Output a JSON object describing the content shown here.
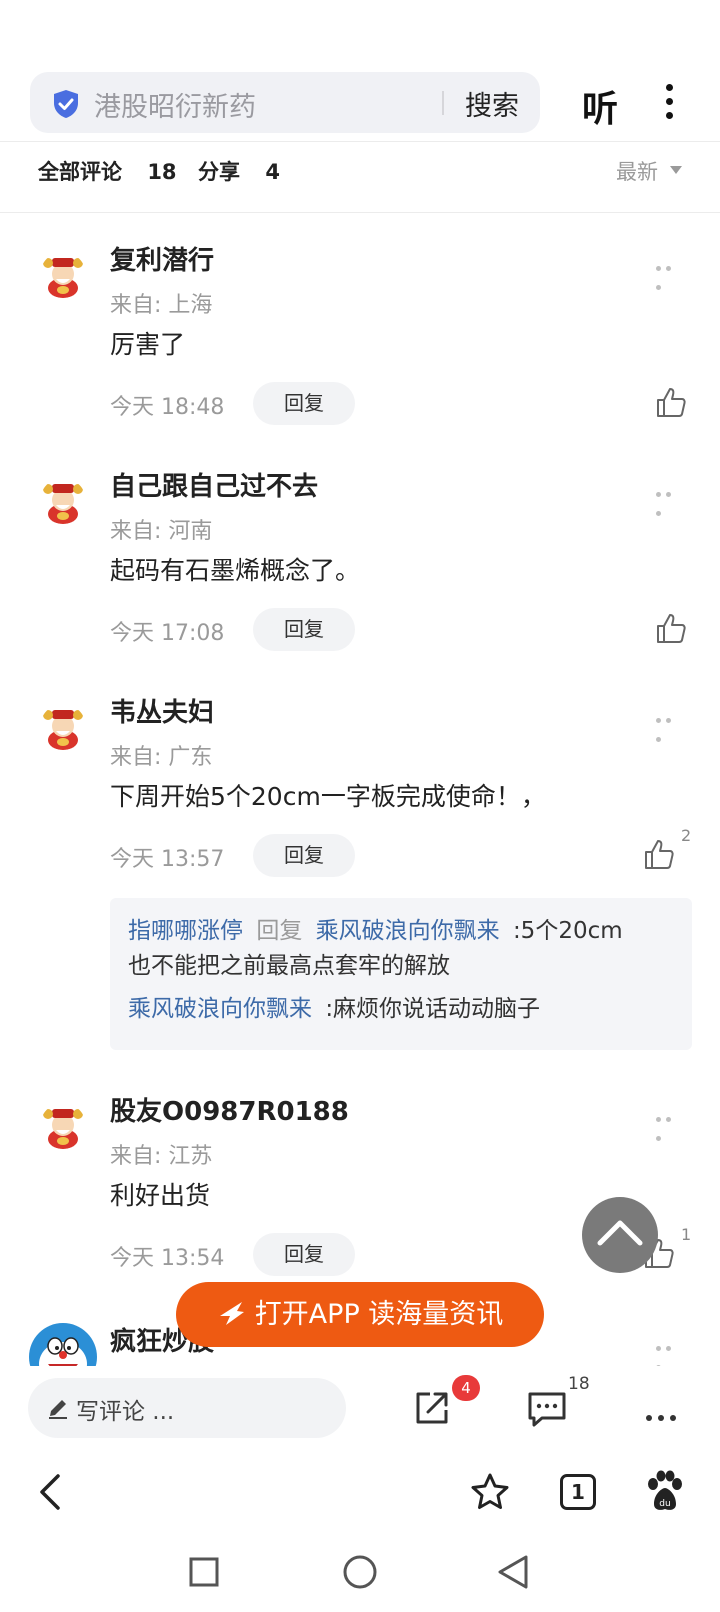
{
  "search": {
    "text": "港股昭衍新药",
    "button_label": "搜索"
  },
  "header": {
    "listen_label": "听"
  },
  "tabs": {
    "all_comments_label": "全部评论",
    "comments_count": "18",
    "share_label": "分享",
    "share_count": "4",
    "sort_label": "最新"
  },
  "comments": [
    {
      "name": "复利潜行",
      "location": "来自: 上海",
      "text": "厉害了",
      "time": "今天 18:48",
      "reply_label": "回复"
    },
    {
      "name": "自己跟自己过不去",
      "location": "来自: 河南",
      "text": "起码有石墨烯概念了。",
      "time": "今天 17:08",
      "reply_label": "回复"
    },
    {
      "name": "韦丛夫妇",
      "location": "来自: 广东",
      "text": "下周开始5个20cm一字板完成使命！，",
      "time": "今天 13:57",
      "reply_label": "回复",
      "like_count": "2",
      "sub_replies": [
        {
          "user": "指哪哪涨停",
          "reply_word": "回复",
          "target": "乘风破浪向你飘来",
          "text_line1": ":5个20cm",
          "text_line2": "也不能把之前最高点套牢的解放"
        },
        {
          "user": "乘风破浪向你飘来",
          "text": ":麻烦你说话动动脑子"
        }
      ]
    },
    {
      "name": "股友O0987R0188",
      "location": "来自: 江苏",
      "text": "利好出货",
      "time": "今天 13:54",
      "reply_label": "回复",
      "like_count": "1"
    },
    {
      "name": "疯狂炒股"
    }
  ],
  "open_app": {
    "label": "打开APP 读海量资讯"
  },
  "bottom_bar": {
    "write_placeholder": "写评论 ...",
    "share_badge": "4",
    "comment_count": "18"
  },
  "browser_nav": {
    "tabs_count": "1"
  },
  "colors": {
    "accent_orange": "#ee5a12",
    "link_blue": "#3d6aa8",
    "badge_red": "#e83a3a"
  }
}
